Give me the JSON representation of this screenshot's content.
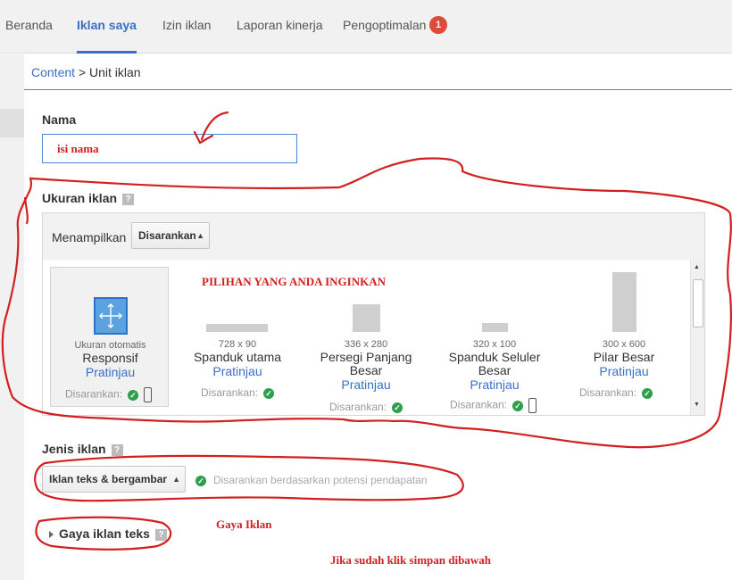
{
  "tabs": [
    {
      "label": "Beranda",
      "active": false
    },
    {
      "label": "Iklan saya",
      "active": true
    },
    {
      "label": "Izin iklan",
      "active": false
    },
    {
      "label": "Laporan kinerja",
      "active": false
    },
    {
      "label": "Pengoptimalan",
      "active": false,
      "badge": "1"
    }
  ],
  "breadcrumb": {
    "link": "Content",
    "separator": ">",
    "current": "Unit iklan"
  },
  "name_section": {
    "label": "Nama",
    "input_value": "isi nama"
  },
  "size_section": {
    "label": "Ukuran iklan",
    "help": "?",
    "show_label": "Menampilkan",
    "sort_select": "Disarankan",
    "recommended_label": "Disarankan:",
    "responsive": {
      "small": "Ukuran otomatis",
      "name": "Responsif",
      "preview": "Pratinjau"
    },
    "sizes": [
      {
        "dim": "728 x 90",
        "name_line1": "Spanduk utama",
        "name_line2": "",
        "preview": "Pratinjau"
      },
      {
        "dim": "336 x 280",
        "name_line1": "Persegi Panjang",
        "name_line2": "Besar",
        "preview": "Pratinjau"
      },
      {
        "dim": "320 x 100",
        "name_line1": "Spanduk Seluler",
        "name_line2": "Besar",
        "preview": "Pratinjau"
      },
      {
        "dim": "300 x 600",
        "name_line1": "Pilar Besar",
        "name_line2": "",
        "preview": "Pratinjau"
      }
    ]
  },
  "type_section": {
    "label": "Jenis iklan",
    "help": "?",
    "select": "Iklan teks & bergambar",
    "note": "Disarankan berdasarkan potensi pendapatan"
  },
  "style_section": {
    "label": "Gaya iklan teks",
    "help": "?"
  },
  "annotations": {
    "choice": "PILIHAN YANG ANDA INGINKAN",
    "style": "Gaya Iklan",
    "save_note": "Jika sudah klik simpan dibawah"
  },
  "colors": {
    "accent": "#3a6fc7",
    "badge": "#dd4b39",
    "annotation": "#d21f1f",
    "check": "#2e9e4b"
  },
  "icons": {
    "check": "check-circle-icon",
    "phone": "mobile-phone-icon",
    "resize": "resize-arrows-icon",
    "updown": "up-down-arrows-icon"
  }
}
